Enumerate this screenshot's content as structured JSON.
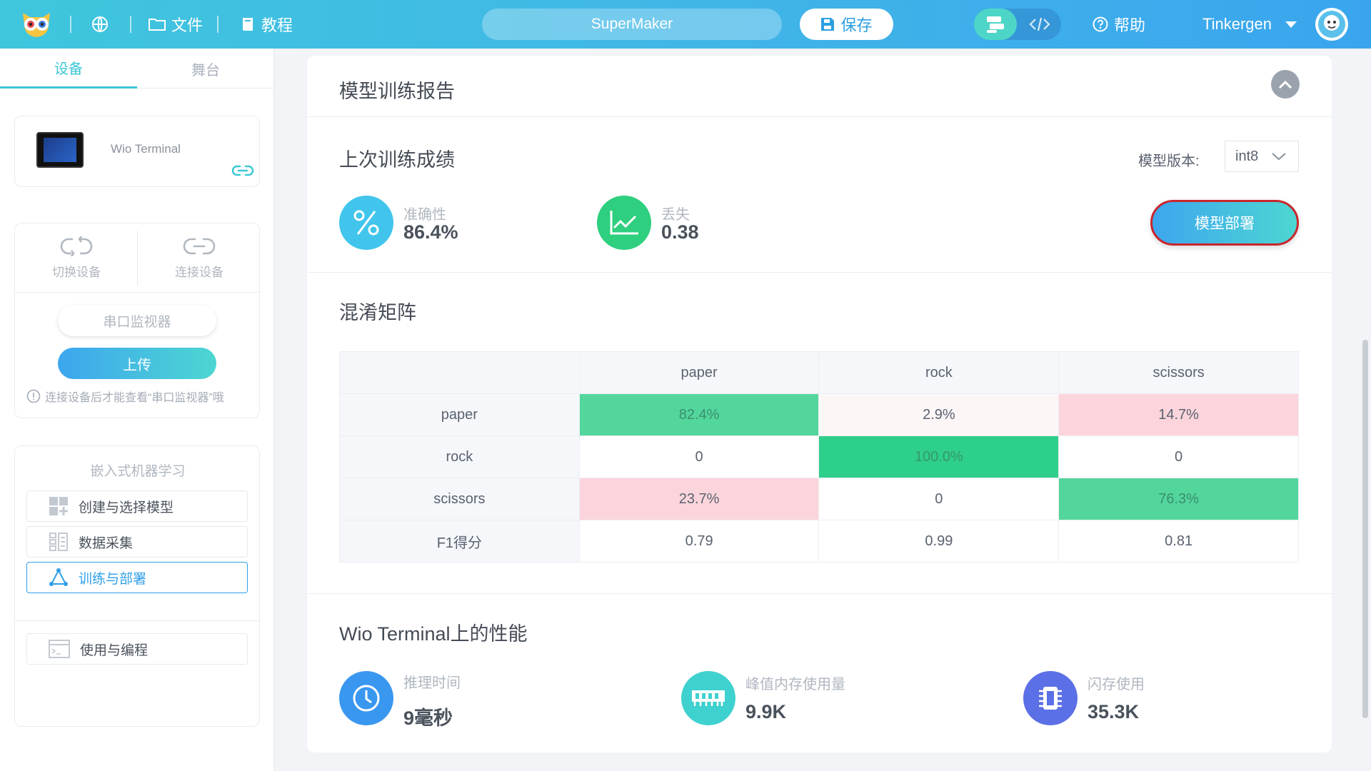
{
  "topbar": {
    "file_label": "文件",
    "tutorial_label": "教程",
    "project_name": "SuperMaker",
    "save_label": "保存",
    "help_label": "帮助",
    "user_name": "Tinkergen"
  },
  "sidebar": {
    "tabs": [
      "设备",
      "舞台"
    ],
    "device_name": "Wio Terminal",
    "switch_device": "切换设备",
    "connect_device": "连接设备",
    "serial_monitor": "串口监视器",
    "upload": "上传",
    "hint": "连接设备后才能查看“串口监视器”哦",
    "ml_title": "嵌入式机器学习",
    "ml_items": [
      "创建与选择模型",
      "数据采集",
      "训练与部署",
      "使用与编程"
    ]
  },
  "report": {
    "title": "模型训练报告",
    "last_training_title": "上次训练成绩",
    "version_label": "模型版本:",
    "version_value": "int8",
    "accuracy_label": "准确性",
    "accuracy_value": "86.4%",
    "loss_label": "丢失",
    "loss_value": "0.38",
    "deploy_label": "模型部署",
    "confusion_title": "混淆矩阵",
    "matrix": {
      "columns": [
        "paper",
        "rock",
        "scissors"
      ],
      "rows": [
        {
          "label": "paper",
          "cells": [
            "82.4%",
            "2.9%",
            "14.7%"
          ]
        },
        {
          "label": "rock",
          "cells": [
            "0",
            "100.0%",
            "0"
          ]
        },
        {
          "label": "scissors",
          "cells": [
            "23.7%",
            "0",
            "76.3%"
          ]
        },
        {
          "label": "F1得分",
          "cells": [
            "0.79",
            "0.99",
            "0.81"
          ]
        }
      ]
    },
    "perf_title": "Wio Terminal上的性能",
    "inference_label": "推理时间",
    "inference_value": "9毫秒",
    "ram_label": "峰值内存使用量",
    "ram_value": "9.9K",
    "flash_label": "闪存使用",
    "flash_value": "35.3K"
  },
  "colors": {
    "accent": "#3cc8d6",
    "primary": "#3da6ee",
    "green": "#2ecf8a",
    "pink": "#fcd5dc"
  }
}
